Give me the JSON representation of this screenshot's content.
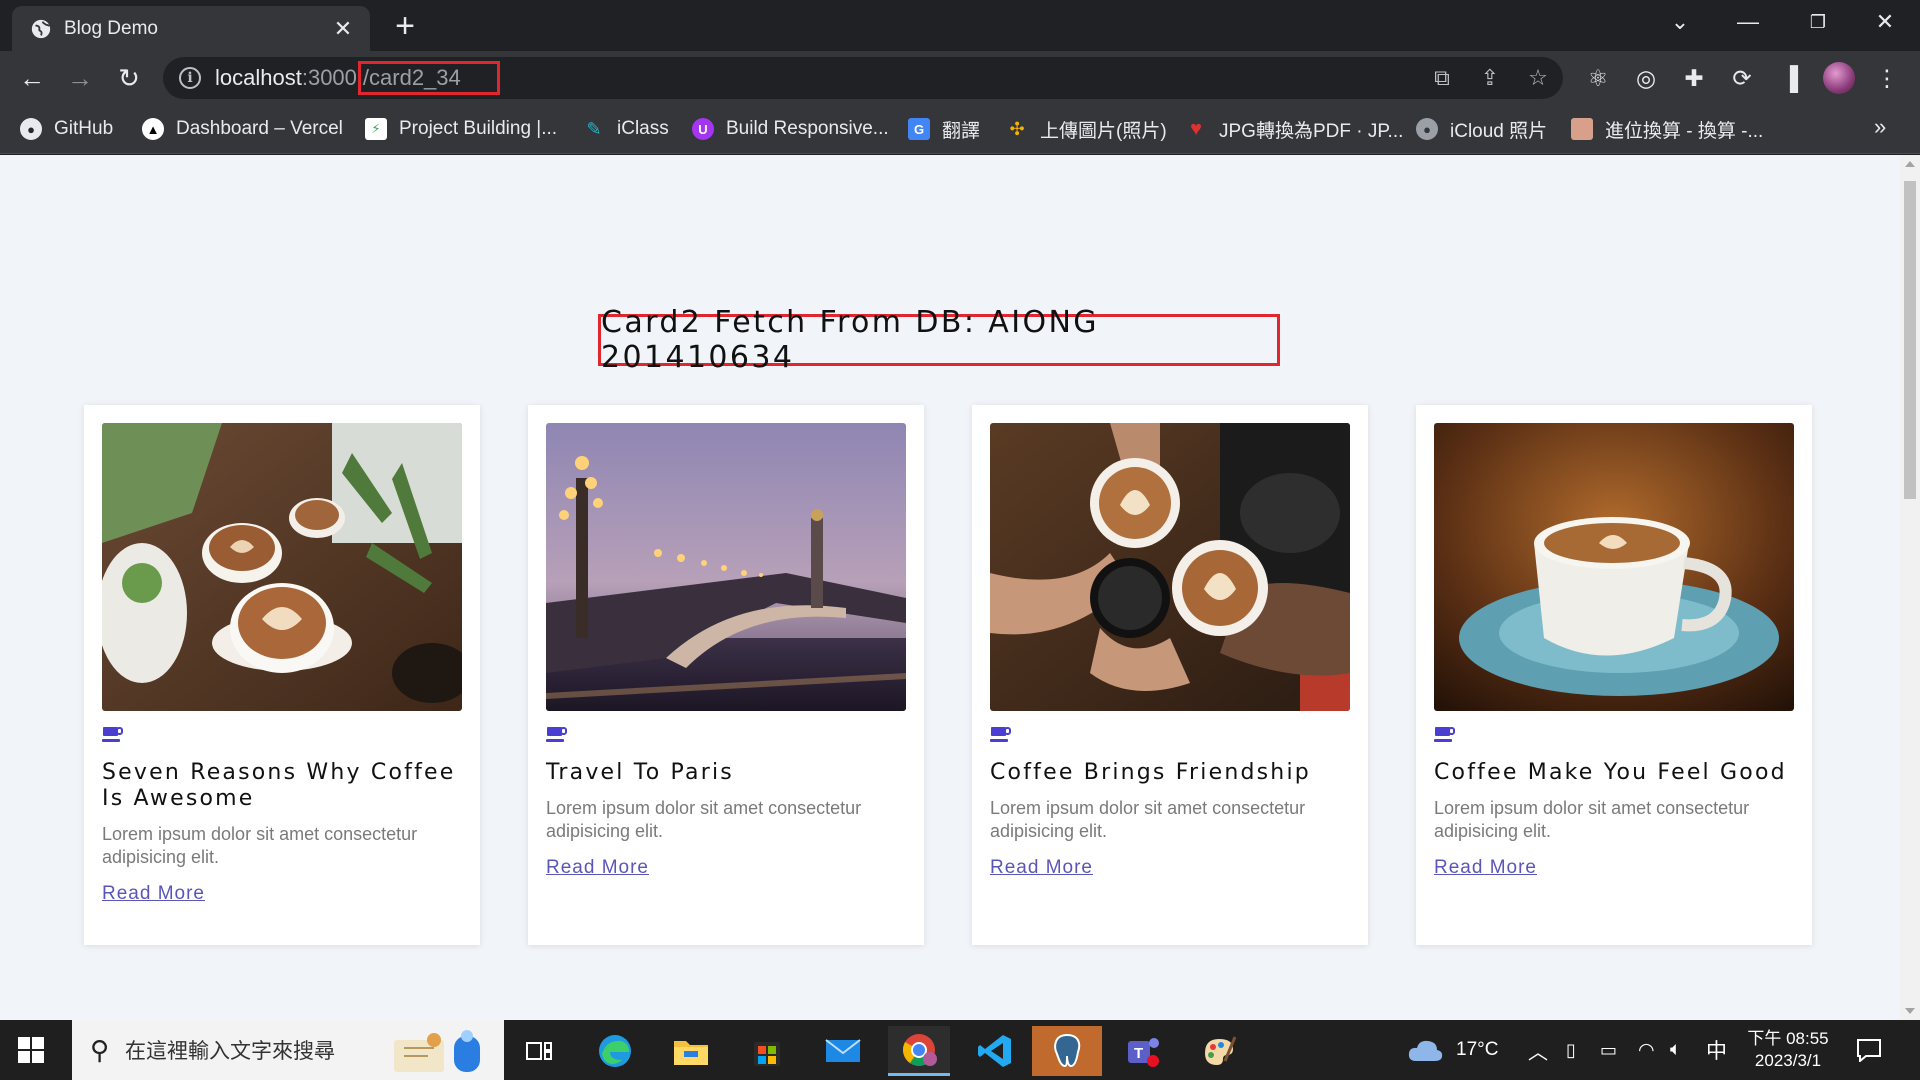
{
  "browser": {
    "tab_title": "Blog Demo",
    "url": {
      "host": "localhost",
      "port": ":3000",
      "path": "/card2_34"
    }
  },
  "bookmarks": [
    {
      "label": "GitHub",
      "icon": "github-icon",
      "color": "#24292f"
    },
    {
      "label": "Dashboard – Vercel",
      "icon": "vercel-icon",
      "color": "#000000"
    },
    {
      "label": "Project Building |...",
      "icon": "project-icon",
      "color": "#1a73e8"
    },
    {
      "label": "iClass",
      "icon": "iclass-icon",
      "color": "#2bb0c9"
    },
    {
      "label": "Build Responsive...",
      "icon": "udemy-icon",
      "color": "#a435f0"
    },
    {
      "label": "翻譯",
      "icon": "translate-icon",
      "color": "#4285f4"
    },
    {
      "label": "上傳圖片(照片)",
      "icon": "upload-icon",
      "color": "#f4b400"
    },
    {
      "label": "JPG轉換為PDF · JP...",
      "icon": "heart-icon",
      "color": "#e03131"
    },
    {
      "label": "iCloud 照片",
      "icon": "apple-icon",
      "color": "#9aa0a6"
    },
    {
      "label": "進位換算 - 換算 -...",
      "icon": "avatar-icon",
      "color": "#d8a08a"
    }
  ],
  "page": {
    "heading": "Card2 Fetch From DB: AIONG 201410634",
    "cards": [
      {
        "title": "Seven Reasons Why Coffee Is Awesome",
        "description": "Lorem ipsum dolor sit amet consectetur adipisicing elit.",
        "link": "Read More",
        "image": "coffee-cups-latte-art"
      },
      {
        "title": "Travel To Paris",
        "description": "Lorem ipsum dolor sit amet consectetur adipisicing elit.",
        "link": "Read More",
        "image": "paris-bridge-dusk"
      },
      {
        "title": "Coffee Brings Friendship",
        "description": "Lorem ipsum dolor sit amet consectetur adipisicing elit.",
        "link": "Read More",
        "image": "hands-toasting-coffee"
      },
      {
        "title": "Coffee Make You Feel Good",
        "description": "Lorem ipsum dolor sit amet consectetur adipisicing elit.",
        "link": "Read More",
        "image": "coffee-cup-saucer"
      }
    ]
  },
  "taskbar": {
    "search_placeholder": "在這裡輸入文字來搜尋",
    "weather": "17°C",
    "ime": "中",
    "time": "下午 08:55",
    "date": "2023/3/1"
  },
  "colors": {
    "highlight_border": "#e0272f",
    "link": "#5a56b8",
    "accent_icon": "#4b3fd1",
    "page_bg": "#f1f4f8"
  }
}
